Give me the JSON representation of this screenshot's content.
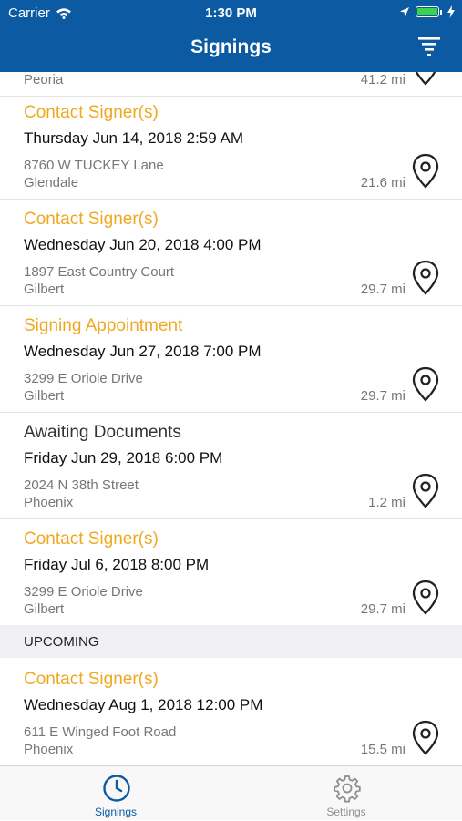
{
  "status_bar": {
    "carrier": "Carrier",
    "time": "1:30 PM"
  },
  "nav": {
    "title": "Signings",
    "filter_icon": "filter-icon"
  },
  "partial_row": {
    "city": "Peoria",
    "distance": "41.2 mi"
  },
  "rows": [
    {
      "title": "Contact Signer(s)",
      "status_color": "#f0a821",
      "date": "Thursday Jun 14, 2018 2:59 AM",
      "address": "8760 W TUCKEY Lane",
      "city": "Glendale",
      "distance": "21.6 mi"
    },
    {
      "title": "Contact Signer(s)",
      "status_color": "#f0a821",
      "date": "Wednesday Jun 20, 2018 4:00 PM",
      "address": "1897 East Country Court",
      "city": "Gilbert",
      "distance": "29.7 mi"
    },
    {
      "title": "Signing Appointment",
      "status_color": "#f0a821",
      "date": "Wednesday Jun 27, 2018 7:00 PM",
      "address": "3299 E Oriole Drive",
      "city": "Gilbert",
      "distance": "29.7 mi"
    },
    {
      "title": "Awaiting Documents",
      "status_color": "#333333",
      "date": "Friday Jun 29, 2018 6:00 PM",
      "address": "2024 N 38th Street",
      "city": "Phoenix",
      "distance": "1.2 mi"
    },
    {
      "title": "Contact Signer(s)",
      "status_color": "#f0a821",
      "date": "Friday Jul 6, 2018 8:00 PM",
      "address": "3299 E Oriole Drive",
      "city": "Gilbert",
      "distance": "29.7 mi"
    }
  ],
  "section": {
    "label": "UPCOMING"
  },
  "upcoming_rows": [
    {
      "title": "Contact Signer(s)",
      "status_color": "#f0a821",
      "date": "Wednesday Aug 1, 2018 12:00 PM",
      "address": "611 E Winged Foot Road",
      "city": "Phoenix",
      "distance": "15.5 mi"
    }
  ],
  "tabbar": {
    "tabs": [
      {
        "label": "Signings",
        "icon": "clock-icon",
        "active": true,
        "color": "#0b5aa2"
      },
      {
        "label": "Settings",
        "icon": "gear-icon",
        "active": false,
        "color": "#8e8e93"
      }
    ]
  },
  "colors": {
    "header_bg": "#0b5aa2",
    "accent": "#f0a821",
    "section_bg": "#efeff4",
    "battery": "#3ad44c"
  }
}
